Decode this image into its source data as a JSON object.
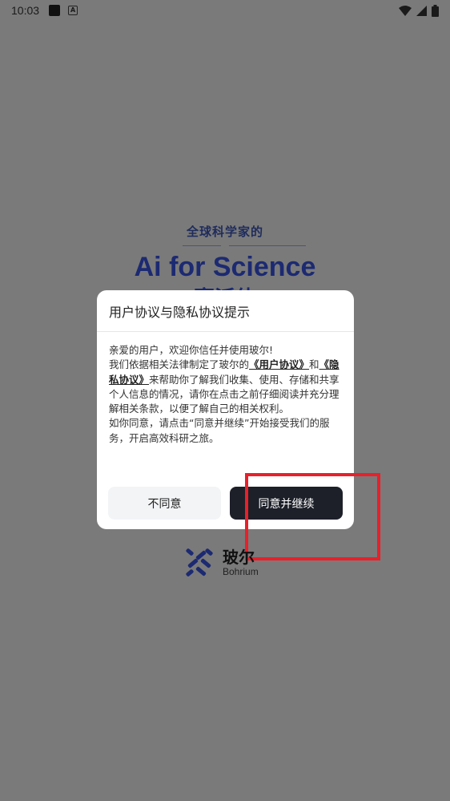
{
  "status_bar": {
    "time": "10:03"
  },
  "splash": {
    "subtitle": "全球科学家的",
    "title": "Ai for Science",
    "title_line2": "赛派体"
  },
  "dialog": {
    "title": "用户协议与隐私协议提示",
    "line1": "亲爱的用户，欢迎你信任并使用玻尔!",
    "line2_prefix": "我们依据相关法律制定了玻尔的",
    "user_agreement_link": "《用户协议》",
    "line2_mid": "和",
    "privacy_link": "《隐私协议》",
    "line2_suffix": "来帮助你了解我们收集、使用、存储和共享个人信息的情况，请你在点击之前仔细阅读并充分理解相关条款，以便了解自己的相关权利。",
    "line3": "如你同意，请点击“同意并继续”开始接受我们的服务，开启高效科研之旅。",
    "decline_label": "不同意",
    "agree_label": "同意并继续"
  },
  "logo": {
    "name_cn": "玻尔",
    "name_en": "Bohrium"
  },
  "colors": {
    "overlay": "#7a7a7a",
    "agree_button": "#1d2029",
    "highlight": "#e8202a",
    "brand_blue": "#1c2a72"
  }
}
